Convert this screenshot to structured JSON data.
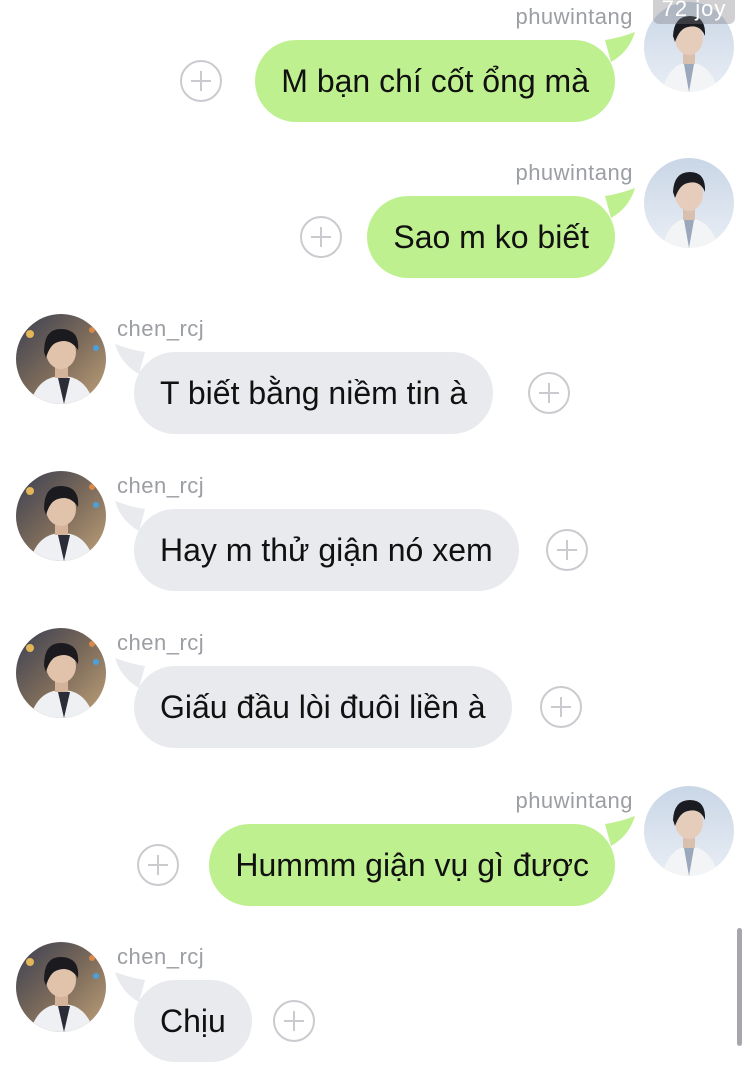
{
  "colors": {
    "outgoing_bubble": "#bff08f",
    "incoming_bubble": "#e8eaed",
    "sender_name": "#9b9ea3",
    "plus_icon": "#c9cbcf"
  },
  "watermark": "72 joy",
  "messages": [
    {
      "direction": "outgoing",
      "sender": "phuwintang",
      "text": "M bạn chí cốt ổng mà",
      "action_icon": "plus-icon",
      "avatar_icon": "user-avatar"
    },
    {
      "direction": "outgoing",
      "sender": "phuwintang",
      "text": "Sao m ko biết",
      "action_icon": "plus-icon",
      "avatar_icon": "user-avatar"
    },
    {
      "direction": "incoming",
      "sender": "chen_rcj",
      "text": "T biết bằng niềm tin à",
      "action_icon": "plus-icon",
      "avatar_icon": "contact-avatar"
    },
    {
      "direction": "incoming",
      "sender": "chen_rcj",
      "text": "Hay m thử giận nó xem",
      "action_icon": "plus-icon",
      "avatar_icon": "contact-avatar"
    },
    {
      "direction": "incoming",
      "sender": "chen_rcj",
      "text": "Giấu đầu lòi đuôi liền à",
      "action_icon": "plus-icon",
      "avatar_icon": "contact-avatar"
    },
    {
      "direction": "outgoing",
      "sender": "phuwintang",
      "text": "Hummm giận vụ gì được",
      "action_icon": "plus-icon",
      "avatar_icon": "user-avatar"
    },
    {
      "direction": "incoming",
      "sender": "chen_rcj",
      "text": "Chịu",
      "action_icon": "plus-icon",
      "avatar_icon": "contact-avatar"
    }
  ]
}
